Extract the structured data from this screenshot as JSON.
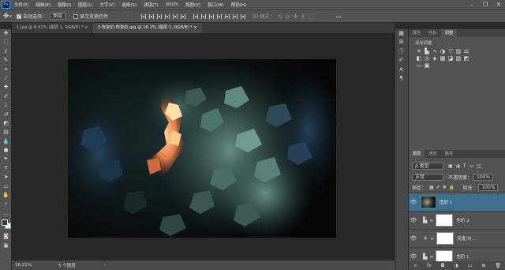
{
  "app": {
    "logo": "Ps"
  },
  "menu": [
    "文件(F)",
    "编辑(E)",
    "图像(I)",
    "图层(L)",
    "文字(Y)",
    "选择(S)",
    "滤镜(T)",
    "3D(D)",
    "视图(V)",
    "窗口(W)",
    "帮助(H)"
  ],
  "window_controls": {
    "minimize": "–",
    "restore": "❐",
    "close": "✕"
  },
  "options": {
    "auto_select_label": "自动选择：",
    "auto_select_value": "图层",
    "show_transform_label": "显示变换控件",
    "mode3d_label": "3D 模式："
  },
  "tabs": [
    {
      "label": "1.jpg @ 8.32% (图层 1, RGB/8) *",
      "close": "×"
    },
    {
      "label": "2-恢复的-恢复的.jpg @ 16.2% (图层 1, RGB/8) *",
      "close": "×"
    }
  ],
  "status": {
    "zoom": "16.21%",
    "info": "5 个图层"
  },
  "panels": {
    "top_tabs": [
      "属性",
      "色板",
      "调整"
    ],
    "add_adjustment": "添加调整",
    "layer_tabs": [
      "图层",
      "通道",
      "路径"
    ],
    "filter_kind": "ρ 类型",
    "blend_mode": "正常",
    "opacity_label": "不透明度：",
    "opacity_value": "100%",
    "lock_label": "锁定：",
    "fill_label": "填充：",
    "fill_value": "100%"
  },
  "layers": [
    {
      "name": "图层 1",
      "type": "image"
    },
    {
      "name": "色阶 2",
      "type": "levels"
    },
    {
      "name": "亮度/对...",
      "type": "brightness"
    },
    {
      "name": "色阶 1",
      "type": "levels"
    }
  ],
  "colors": {
    "accent": "#31a8ff",
    "chrome": "#535353",
    "foreground": "#1e4a3a",
    "background": "#f2f2f2"
  }
}
